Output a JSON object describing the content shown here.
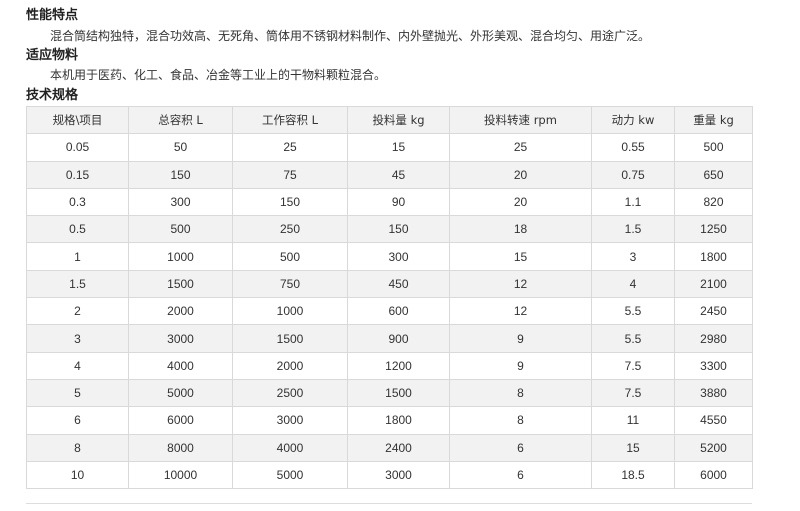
{
  "sections": {
    "features": {
      "title": "性能特点",
      "text": "混合筒结构独特，混合功效高、无死角、筒体用不锈钢材料制作、内外壁抛光、外形美观、混合均匀、用途广泛。"
    },
    "materials": {
      "title": "适应物料",
      "text": "本机用于医药、化工、食品、冶金等工业上的干物料颗粒混合。"
    },
    "specs": {
      "title": "技术规格"
    }
  },
  "table": {
    "headers": [
      "规格\\项目",
      "总容积 L",
      "工作容积 L",
      "投料量 kg",
      "投料转速 rpm",
      "动力 kw",
      "重量 kg"
    ],
    "rows": [
      [
        "0.05",
        "50",
        "25",
        "15",
        "25",
        "0.55",
        "500"
      ],
      [
        "0.15",
        "150",
        "75",
        "45",
        "20",
        "0.75",
        "650"
      ],
      [
        "0.3",
        "300",
        "150",
        "90",
        "20",
        "1.1",
        "820"
      ],
      [
        "0.5",
        "500",
        "250",
        "150",
        "18",
        "1.5",
        "1250"
      ],
      [
        "1",
        "1000",
        "500",
        "300",
        "15",
        "3",
        "1800"
      ],
      [
        "1.5",
        "1500",
        "750",
        "450",
        "12",
        "4",
        "2100"
      ],
      [
        "2",
        "2000",
        "1000",
        "600",
        "12",
        "5.5",
        "2450"
      ],
      [
        "3",
        "3000",
        "1500",
        "900",
        "9",
        "5.5",
        "2980"
      ],
      [
        "4",
        "4000",
        "2000",
        "1200",
        "9",
        "7.5",
        "3300"
      ],
      [
        "5",
        "5000",
        "2500",
        "1500",
        "8",
        "7.5",
        "3880"
      ],
      [
        "6",
        "6000",
        "3000",
        "1800",
        "8",
        "11",
        "4550"
      ],
      [
        "8",
        "8000",
        "4000",
        "2400",
        "6",
        "15",
        "5200"
      ],
      [
        "10",
        "10000",
        "5000",
        "3000",
        "6",
        "18.5",
        "6000"
      ]
    ]
  }
}
